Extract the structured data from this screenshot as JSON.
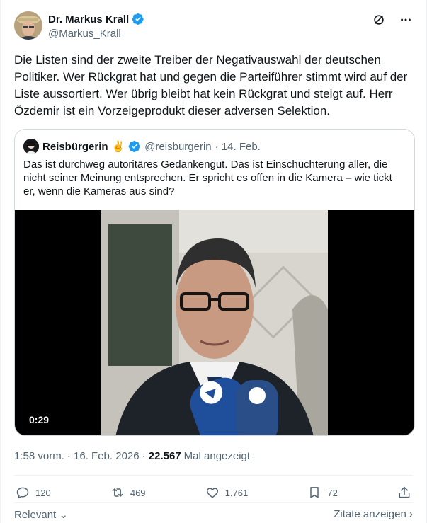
{
  "author": {
    "display_name": "Dr. Markus Krall",
    "handle": "@Markus_Krall"
  },
  "tweet": {
    "text": "Die Listen sind der zweite Treiber der Negativauswahl der deutschen Politiker. Wer Rückgrat hat und gegen die Parteiführer stimmt  wird auf der Liste aussortiert. Wer übrig bleibt hat kein Rückgrat und steigt auf. Herr Özdemir ist ein Vorzeigeprodukt dieser adversen Selektion."
  },
  "quote": {
    "display_name": "Reisbürgerin",
    "emoji": "✌️",
    "handle": "@reisburgerin",
    "date": "· 14. Feb.",
    "text": "Das ist durchweg autoritäres Gedankengut. Das ist Einschüchterung aller, die nicht seiner Meinung entsprechen. Er spricht es offen in die Kamera – wie tickt er, wenn die Kameras aus sind?",
    "video_duration": "0:29"
  },
  "meta": {
    "time": "1:58 vorm.",
    "date": "· 16. Feb. 2026 ·",
    "views": "22.567",
    "views_label": "Mal angezeigt"
  },
  "actions": {
    "replies": "120",
    "reposts": "469",
    "likes": "1.761",
    "bookmarks": "72"
  },
  "footer": {
    "sort_label": "Relevant",
    "quotes_label": "Zitate anzeigen"
  },
  "colors": {
    "verified": "#1d9bf0",
    "text": "#0f1419",
    "muted": "#536471",
    "border": "#cfd9de"
  }
}
